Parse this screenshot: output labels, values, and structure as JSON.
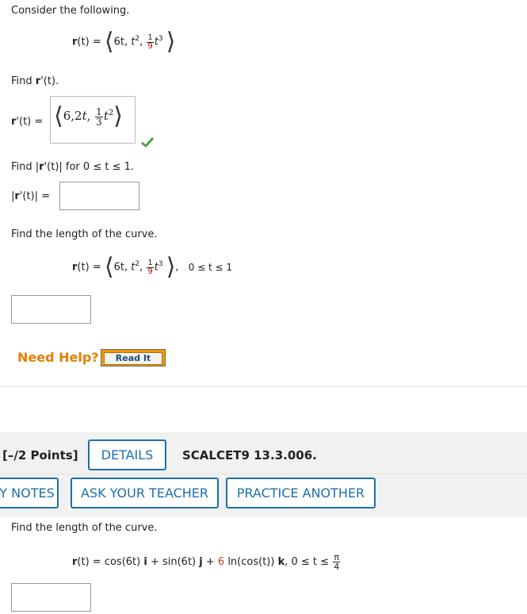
{
  "intro": "Consider the following.",
  "vector": {
    "lhs": "r",
    "arg": "(t)",
    "eq": "=",
    "c1": "6t,",
    "c2": "t",
    "c2exp": "2",
    "c3num": "1",
    "c3den": "9",
    "c3var": "t",
    "c3exp": "3"
  },
  "q1": {
    "prefix": "Find",
    "r": "r",
    "prime": "'",
    "arg": "(t).",
    "label_r": "r",
    "label_rest": "'(t) =",
    "ans": {
      "a": "6,2",
      "t": "t",
      "comma": ",",
      "num": "1",
      "den": "3",
      "var": "t",
      "exp": "2"
    }
  },
  "q2": {
    "prefix": "Find |",
    "r": "r",
    "mid": "'(t)| for 0 ≤ t ≤ 1.",
    "label_pre": "|",
    "label_r": "r",
    "label_rest": "'(t)| ="
  },
  "q3": {
    "text": "Find the length of the curve.",
    "range": "0 ≤ t ≤ 1"
  },
  "help": {
    "label": "Need Help?",
    "read_it": "Read It"
  },
  "problem2": {
    "points": "[–/2 Points]",
    "details": "DETAILS",
    "code": "SCALCET9 13.3.006.",
    "notes": "Y NOTES",
    "ask": "ASK YOUR TEACHER",
    "practice": "PRACTICE ANOTHER",
    "text": "Find the length of the curve.",
    "formula": {
      "lhs": "r",
      "arg": "(t)",
      "eq": " = cos(6t)",
      "i": "i",
      "plus1": " + sin(6t)",
      "j": "j",
      "plus2": " + ",
      "six": "6",
      "ln": " ln(cos(t))",
      "k": "k",
      "range": ",  0 ≤ t ≤",
      "pi": "π",
      "four": "4"
    }
  },
  "colors": {
    "blue": "#1d6fa8",
    "help": "#e47e00",
    "check": "#49a342",
    "red": "#c0392b"
  }
}
